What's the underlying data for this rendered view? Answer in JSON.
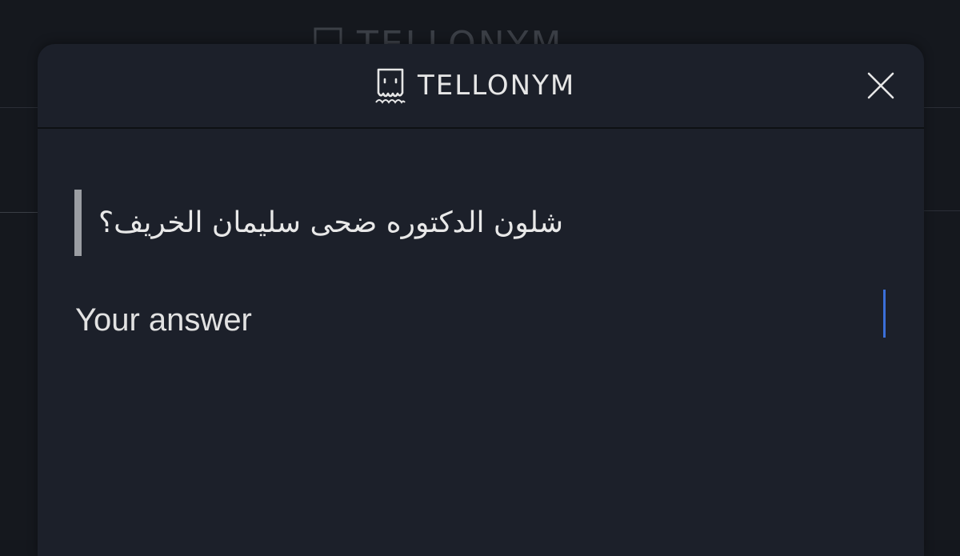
{
  "background": {
    "brand_name": "TELLONYM"
  },
  "modal": {
    "brand_name": "TELLONYM",
    "brand_icon": "tellonym-logo-icon",
    "close_icon": "close-icon"
  },
  "question": {
    "text": "شلون الدكتوره ضحى سليمان الخريف؟"
  },
  "answer": {
    "placeholder": "Your answer",
    "value": ""
  },
  "colors": {
    "modal_bg": "#1c202a",
    "page_bg": "#15181e",
    "caret": "#3b6fd9",
    "question_bar": "#9b9ea3"
  }
}
